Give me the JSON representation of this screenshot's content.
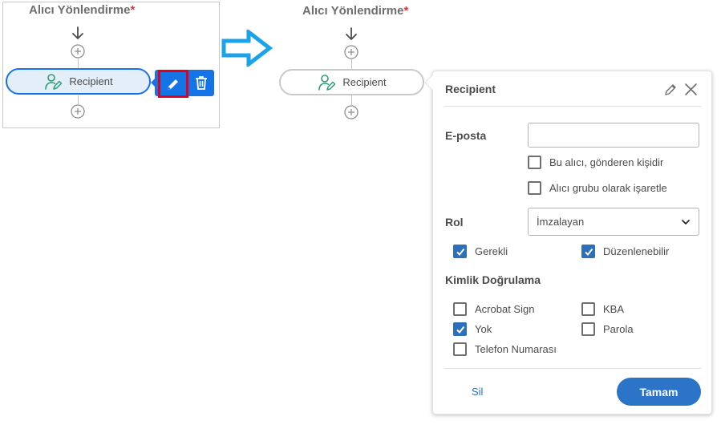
{
  "left_flow": {
    "title": "Alıcı Yönlendirme",
    "required_marker": "*",
    "recipient_label": "Recipient",
    "state": "selected"
  },
  "right_flow": {
    "title": "Alıcı Yönlendirme",
    "required_marker": "*",
    "recipient_label": "Recipient"
  },
  "icons": {
    "recipient": "recipient-signer-icon",
    "edit": "pencil-icon",
    "delete": "trash-icon",
    "add": "plus-circle-icon",
    "flow": "arrow-down-icon",
    "transition": "right-arrow-icon",
    "close": "close-icon",
    "dropdown": "chevron-down-icon",
    "checkmark": "checkmark-icon"
  },
  "panel": {
    "title": "Recipient",
    "email": {
      "label": "E-posta",
      "value": "",
      "placeholder": ""
    },
    "sender_checkbox": {
      "label": "Bu alıcı, gönderen kişidir",
      "checked": false
    },
    "group_checkbox": {
      "label": "Alıcı grubu olarak işaretle",
      "checked": false
    },
    "role": {
      "label": "Rol",
      "selected": "İmzalayan"
    },
    "required_checkbox": {
      "label": "Gerekli",
      "checked": true
    },
    "editable_checkbox": {
      "label": "Düzenlenebilir",
      "checked": true
    },
    "auth": {
      "label": "Kimlik Doğrulama",
      "options": [
        {
          "label": "Acrobat Sign",
          "checked": false
        },
        {
          "label": "KBA",
          "checked": false
        },
        {
          "label": "Yok",
          "checked": true
        },
        {
          "label": "Parola",
          "checked": false
        },
        {
          "label": "Telefon Numarası",
          "checked": false
        }
      ]
    },
    "delete_label": "Sil",
    "ok_label": "Tamam"
  },
  "colors": {
    "accent_blue": "#1473e6",
    "checkbox_blue": "#2c6fbb",
    "highlight_red": "#e2001a",
    "required_red": "#d7373f",
    "transition_arrow": "#1aa3e8",
    "recipient_icon_green": "#2d9d78"
  }
}
